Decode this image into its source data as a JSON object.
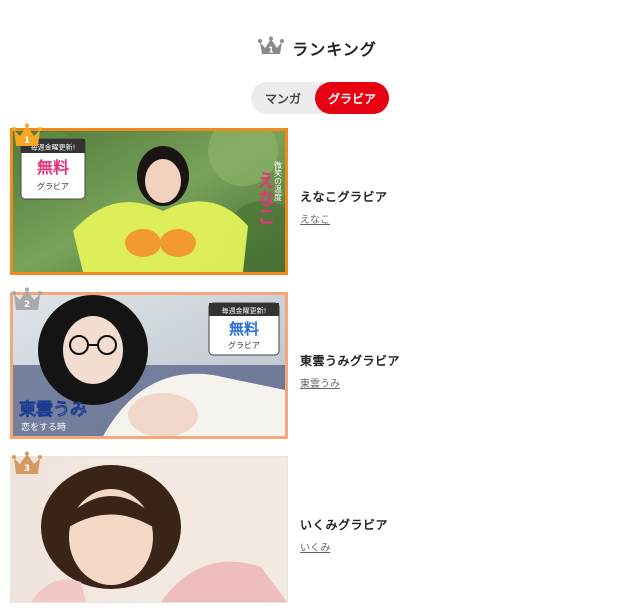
{
  "header": {
    "title": "ランキング",
    "crown_number": "1"
  },
  "tabs": [
    {
      "label": "マンガ",
      "active": false
    },
    {
      "label": "グラビア",
      "active": true
    }
  ],
  "colors": {
    "accent": "#e60012",
    "gold": "#f5a623",
    "silver": "#a9a9a9",
    "bronze": "#d59a63",
    "frame_1": "#f08a1c",
    "frame_2": "#f5a77a"
  },
  "ranking": [
    {
      "rank": "1",
      "title": "えなこグラビア",
      "author": "えなこ",
      "badge_top": "毎週金曜更新!",
      "badge_main": "無料",
      "badge_sub": "グラビア",
      "overlay_name": "えなこ",
      "overlay_sub": "微笑の温度"
    },
    {
      "rank": "2",
      "title": "東雲うみグラビア",
      "author": "東雲うみ",
      "badge_top": "毎週金曜更新!",
      "badge_main": "無料",
      "badge_sub": "グラビア",
      "overlay_name": "東雲うみ",
      "overlay_sub": "恋をする時"
    },
    {
      "rank": "3",
      "title": "いくみグラビア",
      "author": "いくみ"
    }
  ]
}
